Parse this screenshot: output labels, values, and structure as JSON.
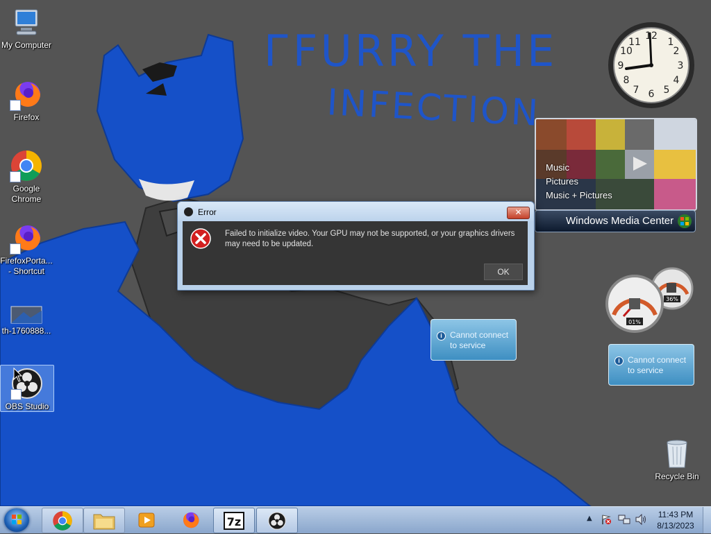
{
  "wallpaper": {
    "line1": "ГFURRY THE",
    "line2": "INFECTION"
  },
  "desktop_icons": [
    {
      "label": "My Computer"
    },
    {
      "label": "Firefox"
    },
    {
      "label": "Google Chrome"
    },
    {
      "label": "FirefoxPorta... - Shortcut"
    },
    {
      "label": "th-1760888..."
    },
    {
      "label": "OBS Studio",
      "selected": true
    },
    {
      "label": "Recycle Bin"
    }
  ],
  "clock_gadget": {
    "time_shown": "11:43"
  },
  "media_center": {
    "menu": [
      "Music",
      "Pictures",
      "Music + Pictures"
    ],
    "brand_bold": "Windows",
    "brand_light": "Media Center"
  },
  "meters": {
    "cpu": "01%",
    "memory": "36%"
  },
  "service_gadgets": [
    {
      "text": "Cannot connect to service"
    },
    {
      "text": "Cannot connect to service"
    }
  ],
  "dialog": {
    "title": "Error",
    "close_label": "✕",
    "message": "Failed to initialize video.  Your GPU may not be supported, or your graphics drivers may need to be updated.",
    "ok_label": "OK"
  },
  "taskbar": {
    "pinned": [
      "Google Chrome",
      "Windows Explorer",
      "Windows Media Player",
      "Firefox",
      "7-Zip",
      "OBS Studio"
    ],
    "time": "11:43 PM",
    "date": "8/13/2023"
  },
  "colors": {
    "wallpaper_gray": "#545454",
    "character_blue": "#1550c8",
    "dialog_body": "#353535",
    "taskbar": "#a9c0e0"
  }
}
